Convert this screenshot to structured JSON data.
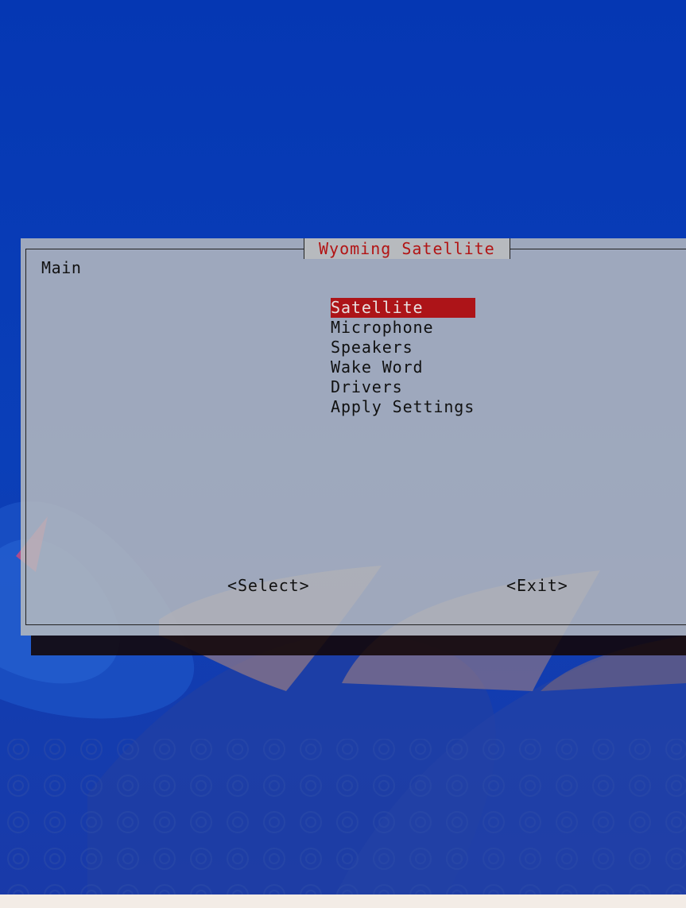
{
  "dialog": {
    "title": "Wyoming Satellite",
    "heading": "Main",
    "menu_items": [
      {
        "label": "Satellite",
        "selected": true
      },
      {
        "label": "Microphone",
        "selected": false
      },
      {
        "label": "Speakers",
        "selected": false
      },
      {
        "label": "Wake Word",
        "selected": false
      },
      {
        "label": "Drivers",
        "selected": false
      },
      {
        "label": "Apply Settings",
        "selected": false
      }
    ],
    "buttons": {
      "select_label": "<Select>",
      "exit_label": "<Exit>"
    }
  },
  "colors": {
    "background": "#0a3cb4",
    "dialog": "#b7babe",
    "accent": "#ad1418",
    "title": "#b21414"
  }
}
